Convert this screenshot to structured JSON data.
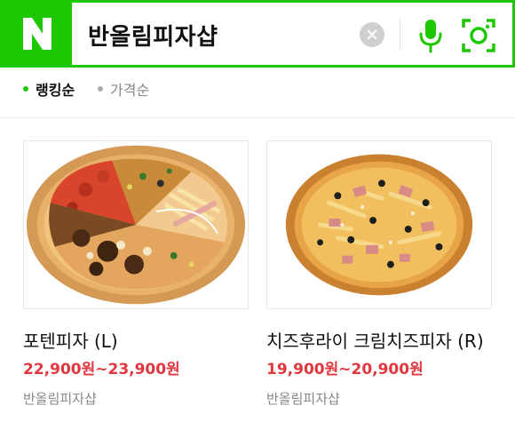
{
  "search": {
    "logo_letter": "N",
    "query": "반올림피자샵"
  },
  "colors": {
    "brand": "#1ec800",
    "price": "#e0383e"
  },
  "sort": {
    "rank_label": "랭킹순",
    "price_label": "가격순"
  },
  "products": [
    {
      "title": "포텐피자 (L)",
      "price": "22,900원~23,900원",
      "shop": "반올림피자샵"
    },
    {
      "title": "치즈후라이 크림치즈피자 (R)",
      "price": "19,900원~20,900원",
      "shop": "반올림피자샵"
    }
  ],
  "icons": {
    "clear": "close-icon",
    "voice": "microphone-icon",
    "lens": "camera-lens-icon"
  }
}
